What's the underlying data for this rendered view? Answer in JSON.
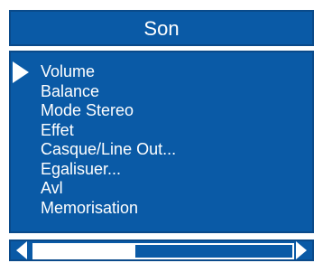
{
  "header": {
    "title": "Son"
  },
  "menu": {
    "selected_index": 0,
    "items": [
      {
        "label": "Volume"
      },
      {
        "label": "Balance"
      },
      {
        "label": "Mode Stereo"
      },
      {
        "label": "Effet"
      },
      {
        "label": "Casque/Line Out..."
      },
      {
        "label": "Egalisuer..."
      },
      {
        "label": "Avl"
      },
      {
        "label": "Memorisation"
      }
    ]
  },
  "slider": {
    "value_fraction": 0.39,
    "left_icon": "triangle-left-icon",
    "right_icon": "triangle-right-icon"
  },
  "colors": {
    "panel_bg": "#0a5aa6",
    "text": "#ffffff"
  }
}
